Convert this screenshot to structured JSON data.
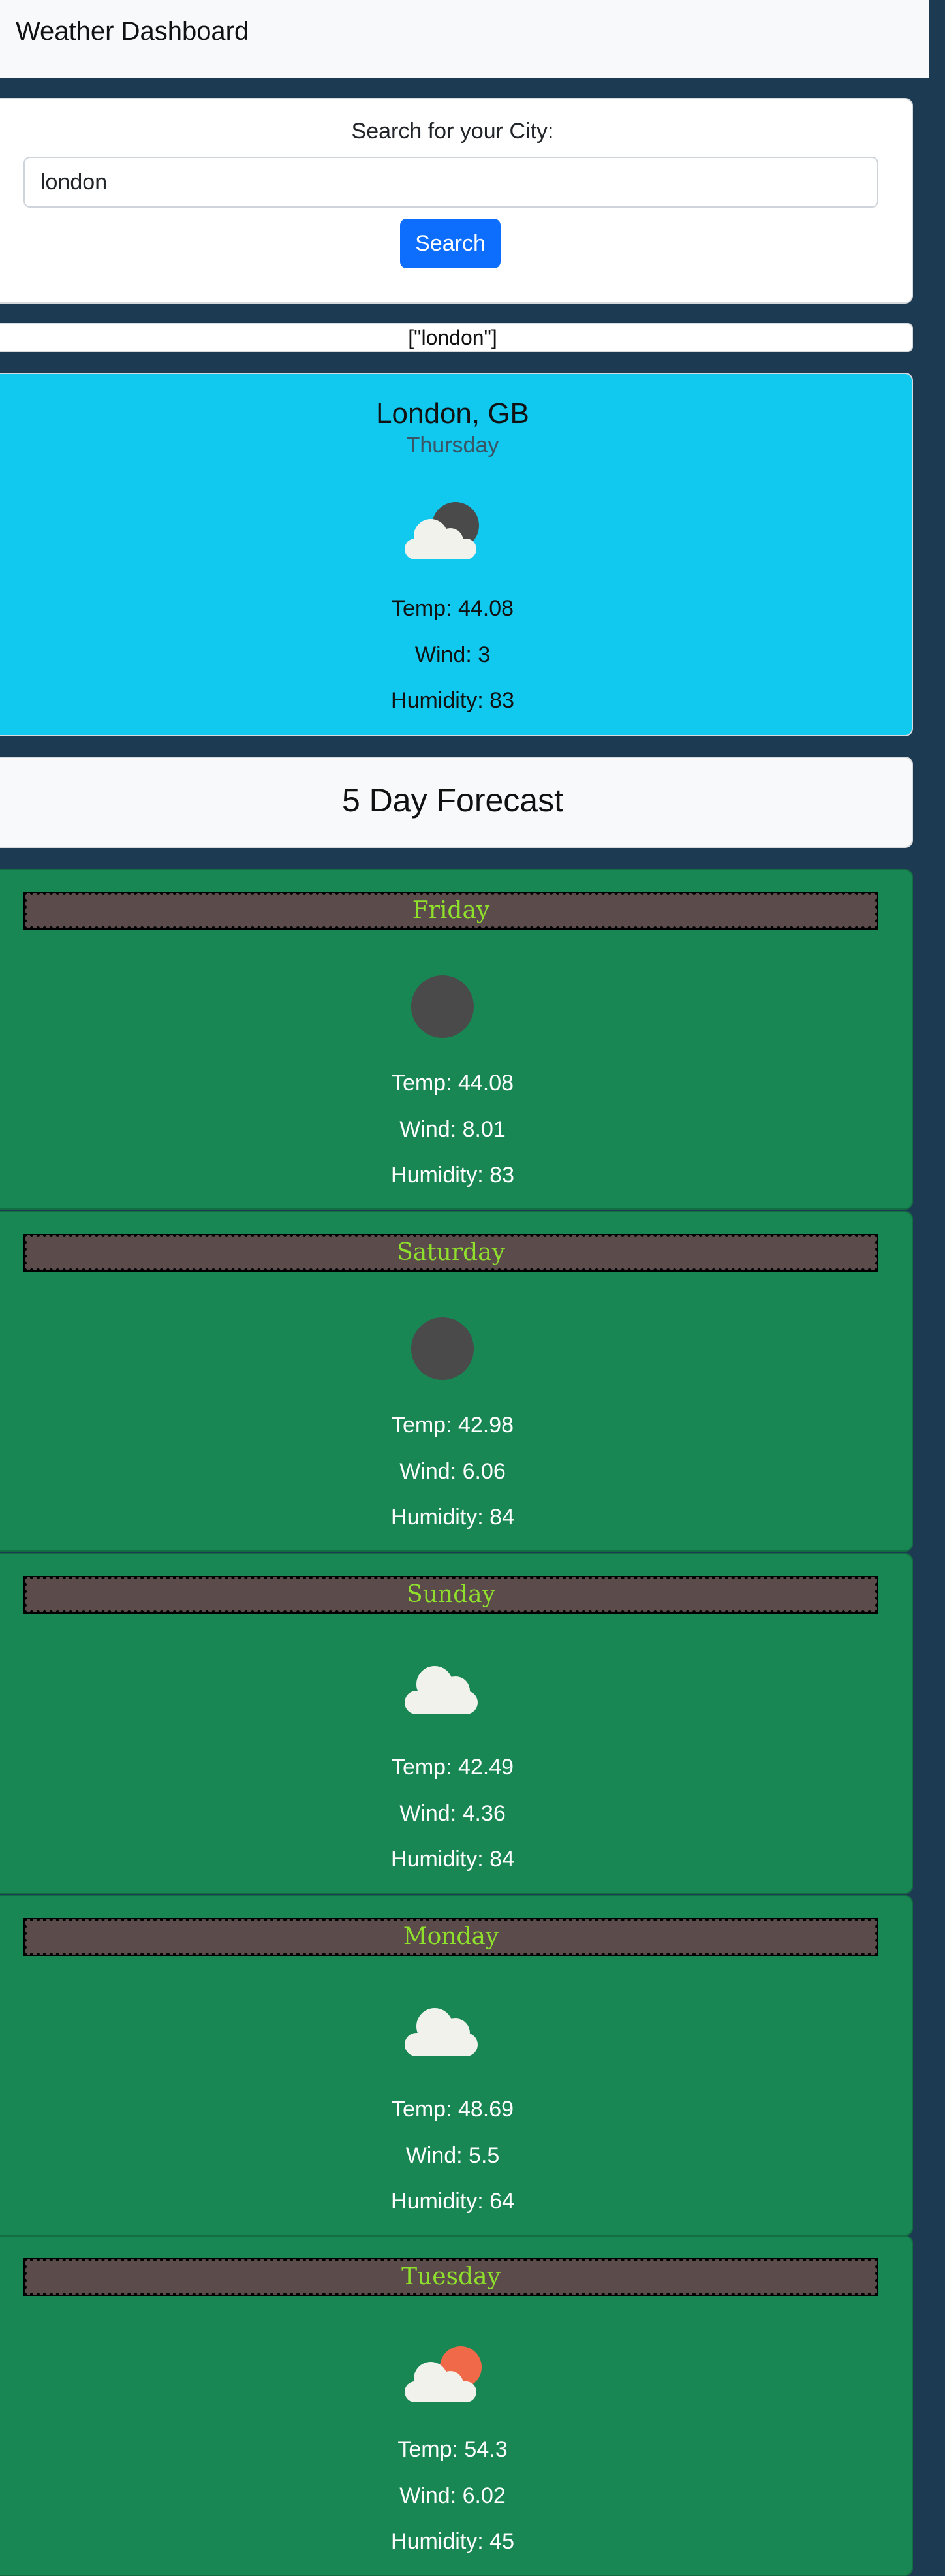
{
  "navbar": {
    "title": "Weather Dashboard"
  },
  "search": {
    "label": "Search for your City:",
    "value": "london",
    "button_label": "Search"
  },
  "history": {
    "text": "[\"london\"]"
  },
  "current": {
    "city": "London, GB",
    "day": "Thursday",
    "icon": "partly-cloudy-night-icon",
    "temp": "Temp: 44.08",
    "wind": "Wind: 3",
    "humidity": "Humidity: 83"
  },
  "forecast": {
    "title": "5 Day Forecast",
    "days": [
      {
        "day": "Friday",
        "icon": "clear-night-icon",
        "temp": "Temp: 44.08",
        "wind": "Wind: 8.01",
        "humidity": "Humidity: 83"
      },
      {
        "day": "Saturday",
        "icon": "clear-night-icon",
        "temp": "Temp: 42.98",
        "wind": "Wind: 6.06",
        "humidity": "Humidity: 84"
      },
      {
        "day": "Sunday",
        "icon": "cloud-icon",
        "temp": "Temp: 42.49",
        "wind": "Wind: 4.36",
        "humidity": "Humidity: 84"
      },
      {
        "day": "Monday",
        "icon": "cloud-icon",
        "temp": "Temp: 48.69",
        "wind": "Wind: 5.5",
        "humidity": "Humidity: 64"
      },
      {
        "day": "Tuesday",
        "icon": "partly-sunny-icon",
        "temp": "Temp: 54.3",
        "wind": "Wind: 6.02",
        "humidity": "Humidity: 45"
      }
    ]
  },
  "colors": {
    "page_bg": "#1c3a52",
    "current_card": "#11c8ef",
    "forecast_card": "#198754",
    "day_tag_bg": "#5c4b4b",
    "day_tag_text": "#8fe02c",
    "button": "#0d6efd",
    "moon": "#4a4a4a",
    "sun": "#f06a4a"
  }
}
